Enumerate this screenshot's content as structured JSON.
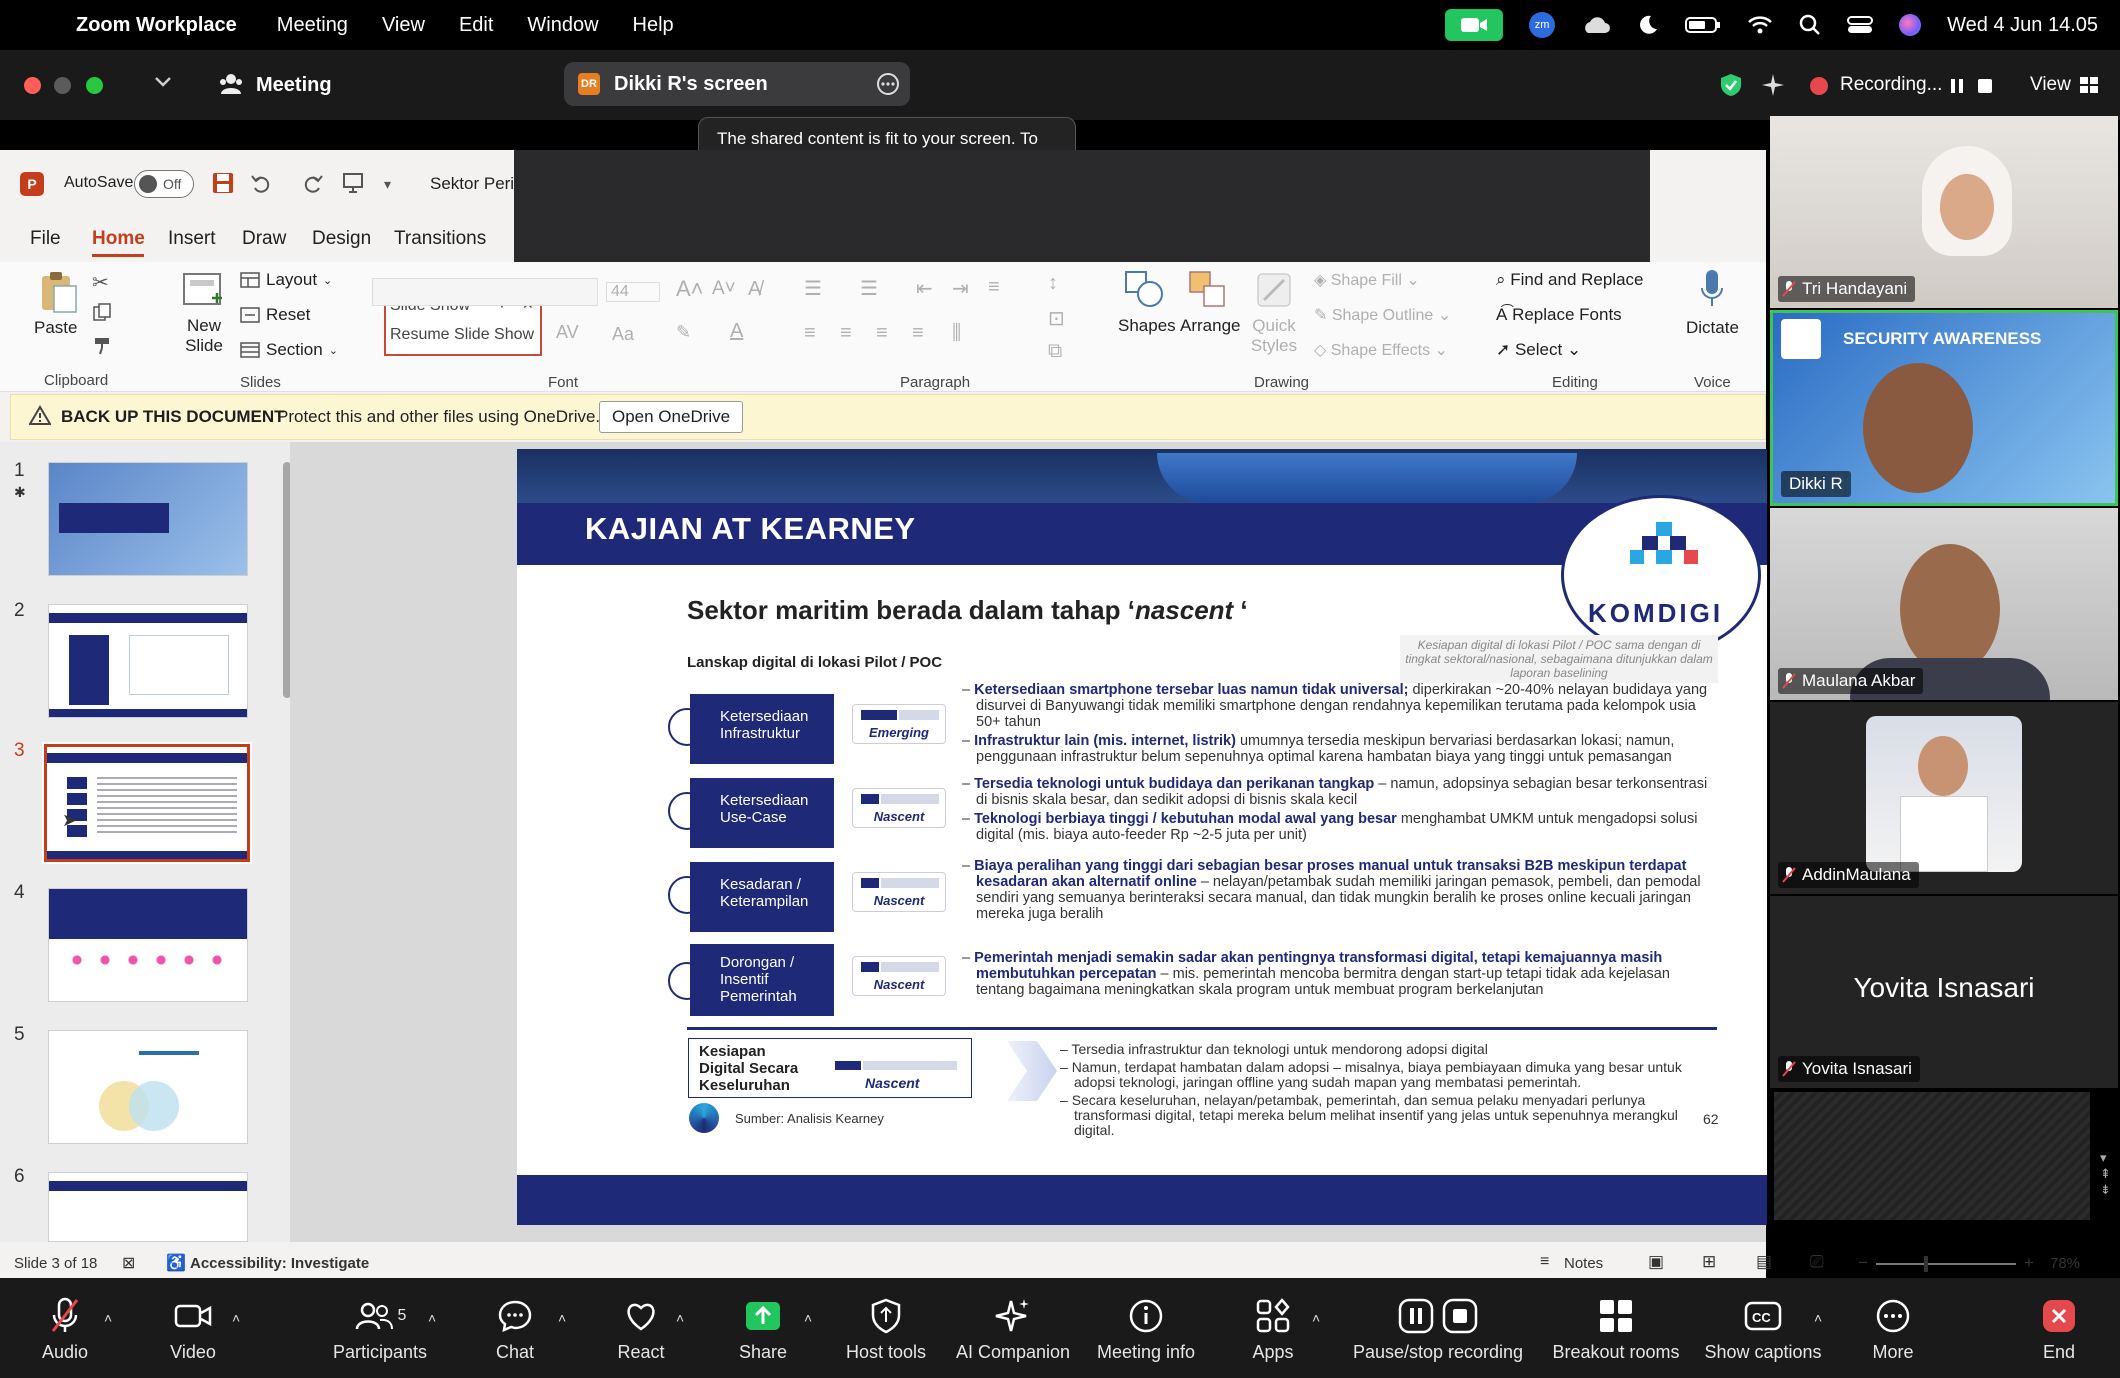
{
  "menubar": {
    "app_name": "Zoom Workplace",
    "items": [
      "Meeting",
      "View",
      "Edit",
      "Window",
      "Help"
    ],
    "datetime": "Wed 4 Jun  14.05"
  },
  "titlebar": {
    "meeting_label": "Meeting",
    "share_initials": "DR",
    "share_title": "Dikki R's screen",
    "recording_label": "Recording...",
    "view_label": "View"
  },
  "tooltip": {
    "text": "The shared content is fit to your screen. To see the original size, click \"Original size\" in the menu."
  },
  "ppt": {
    "autosave_label": "AutoSave",
    "autosave_state": "Off",
    "file_title": "Sektor Peri",
    "tabs": [
      "File",
      "Home",
      "Insert",
      "Draw",
      "Design",
      "Transitions"
    ],
    "active_tab": "Home",
    "clipboard": {
      "paste": "Paste",
      "group": "Clipboard"
    },
    "slides": {
      "new_slide": "New Slide",
      "layout": "Layout",
      "reset": "Reset",
      "section": "Section",
      "group": "Slides"
    },
    "slideshow_popup": {
      "slide_show": "Slide Show",
      "resume": "Resume Slide Show"
    },
    "font": {
      "size": "44",
      "group": "Font"
    },
    "paragraph": {
      "group": "Paragraph"
    },
    "drawing": {
      "shapes": "Shapes",
      "arrange": "Arrange",
      "quick_styles": "Quick Styles",
      "shape_fill": "Shape Fill",
      "shape_outline": "Shape Outline",
      "shape_effects": "Shape Effects",
      "group": "Drawing"
    },
    "editing": {
      "find_replace": "Find and Replace",
      "replace_fonts": "Replace Fonts",
      "select": "Select",
      "group": "Editing"
    },
    "voice": {
      "dictate": "Dictate",
      "group": "Voice"
    },
    "onedrive": {
      "title": "BACK UP THIS DOCUMENT",
      "message": "Protect this and other files using OneDrive.",
      "button": "Open OneDrive"
    },
    "thumbnail_numbers": [
      "1",
      "2",
      "3",
      "4",
      "5",
      "6"
    ],
    "status": {
      "slide_of": "Slide 3 of 18",
      "accessibility": "Accessibility: Investigate",
      "notes": "Notes",
      "zoom": "78%"
    }
  },
  "slide": {
    "header": "KAJIAN AT KEARNEY",
    "logo_text": "KOMDIGI",
    "title_prefix": "Sektor maritim berada dalam tahap ‘",
    "title_italic": "nascent",
    "title_suffix": " ‘",
    "subtitle": "Lanskap digital di lokasi Pilot / POC",
    "side_note": "Kesiapan digital di lokasi Pilot / POC sama dengan di tingkat sektoral/nasional, sebagaimana ditunjukkan dalam laporan baselining",
    "rows": [
      {
        "label": "Ketersediaan Infrastruktur",
        "status": "Emerging",
        "bullets": [
          {
            "bold": "Ketersediaan smartphone tersebar luas namun tidak universal;",
            "text": " diperkirakan ~20-40% nelayan budidaya yang disurvei di Banyuwangi tidak memiliki smartphone dengan rendahnya kepemilikan terutama pada kelompok usia 50+ tahun"
          },
          {
            "bold": "Infrastruktur lain (mis. internet, listrik)",
            "text": " umumnya tersedia meskipun bervariasi berdasarkan lokasi; namun, penggunaan infrastruktur belum sepenuhnya optimal karena hambatan biaya yang tinggi untuk pemasangan"
          }
        ]
      },
      {
        "label": "Ketersediaan Use-Case",
        "status": "Nascent",
        "bullets": [
          {
            "bold": "Tersedia teknologi untuk budidaya dan perikanan tangkap",
            "text": " – namun, adopsinya sebagian besar terkonsentrasi di bisnis skala besar, dan sedikit adopsi di bisnis skala kecil"
          },
          {
            "bold": "Teknologi berbiaya tinggi / kebutuhan modal awal yang besar",
            "text": " menghambat UMKM untuk mengadopsi solusi digital (mis. biaya auto-feeder Rp ~2-5 juta per unit)"
          }
        ]
      },
      {
        "label": "Kesadaran / Keterampilan",
        "status": "Nascent",
        "bullets": [
          {
            "bold": "Biaya peralihan yang tinggi dari sebagian besar proses manual untuk transaksi B2B meskipun terdapat kesadaran akan alternatif online",
            "text": " – nelayan/petambak sudah memiliki jaringan pemasok, pembeli, dan pemodal sendiri yang semuanya berinteraksi secara manual, dan tidak mungkin beralih ke proses online kecuali jaringan mereka juga beralih"
          }
        ]
      },
      {
        "label": "Dorongan / Insentif Pemerintah",
        "status": "Nascent",
        "bullets": [
          {
            "bold": "Pemerintah menjadi semakin sadar akan pentingnya transformasi digital, tetapi kemajuannya masih membutuhkan percepatan",
            "text": " – mis. pemerintah mencoba bermitra dengan start-up tetapi tidak ada kejelasan tentang bagaimana meningkatkan skala program untuk membuat program berkelanjutan"
          }
        ]
      }
    ],
    "summary": {
      "label": "Kesiapan Digital Secara Keseluruhan",
      "status": "Nascent",
      "bullets": [
        {
          "bold": "",
          "text": "Tersedia infrastruktur dan teknologi untuk mendorong adopsi digital"
        },
        {
          "bold": "",
          "text": "Namun, terdapat hambatan dalam adopsi – misalnya, biaya pembiayaan dimuka yang besar untuk adopsi teknologi, jaringan offline yang sudah mapan yang membatasi pemerintah."
        },
        {
          "bold": "",
          "text": "Secara keseluruhan, nelayan/petambak, pemerintah, dan semua pelaku menyadari perlunya transformasi digital, tetapi mereka belum melihat insentif yang jelas untuk sepenuhnya merangkul digital."
        }
      ]
    },
    "source": "Sumber: Analisis Kearney",
    "page_number": "62"
  },
  "participants": [
    {
      "name": "Tri Handayani"
    },
    {
      "name": "Dikki R",
      "background_title": "SECURITY AWARENESS"
    },
    {
      "name": "Maulana Akbar"
    },
    {
      "name": "AddinMaulana"
    },
    {
      "name": "Yovita Isnasari",
      "display_name": "Yovita Isnasari"
    }
  ],
  "toolbar": {
    "audio": "Audio",
    "video": "Video",
    "participants": "Participants",
    "participants_count": "5",
    "chat": "Chat",
    "react": "React",
    "share": "Share",
    "host_tools": "Host tools",
    "ai_companion": "AI Companion",
    "meeting_info": "Meeting info",
    "apps": "Apps",
    "pause_stop": "Pause/stop recording",
    "breakout": "Breakout rooms",
    "captions": "Show captions",
    "more": "More",
    "end": "End"
  },
  "colors": {
    "slide_navy": "#1e2a78",
    "recording_red": "#e5484d",
    "active_speaker_green": "#3ec45d",
    "share_green": "#23c55e"
  }
}
